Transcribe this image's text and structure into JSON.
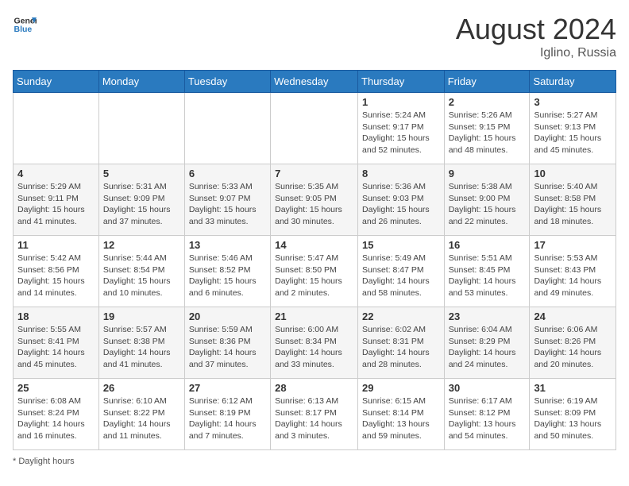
{
  "header": {
    "logo_line1": "General",
    "logo_line2": "Blue",
    "month_year": "August 2024",
    "location": "Iglino, Russia"
  },
  "footer": {
    "note": "Daylight hours"
  },
  "weekdays": [
    "Sunday",
    "Monday",
    "Tuesday",
    "Wednesday",
    "Thursday",
    "Friday",
    "Saturday"
  ],
  "weeks": [
    [
      {
        "day": "",
        "info": ""
      },
      {
        "day": "",
        "info": ""
      },
      {
        "day": "",
        "info": ""
      },
      {
        "day": "",
        "info": ""
      },
      {
        "day": "1",
        "info": "Sunrise: 5:24 AM\nSunset: 9:17 PM\nDaylight: 15 hours\nand 52 minutes."
      },
      {
        "day": "2",
        "info": "Sunrise: 5:26 AM\nSunset: 9:15 PM\nDaylight: 15 hours\nand 48 minutes."
      },
      {
        "day": "3",
        "info": "Sunrise: 5:27 AM\nSunset: 9:13 PM\nDaylight: 15 hours\nand 45 minutes."
      }
    ],
    [
      {
        "day": "4",
        "info": "Sunrise: 5:29 AM\nSunset: 9:11 PM\nDaylight: 15 hours\nand 41 minutes."
      },
      {
        "day": "5",
        "info": "Sunrise: 5:31 AM\nSunset: 9:09 PM\nDaylight: 15 hours\nand 37 minutes."
      },
      {
        "day": "6",
        "info": "Sunrise: 5:33 AM\nSunset: 9:07 PM\nDaylight: 15 hours\nand 33 minutes."
      },
      {
        "day": "7",
        "info": "Sunrise: 5:35 AM\nSunset: 9:05 PM\nDaylight: 15 hours\nand 30 minutes."
      },
      {
        "day": "8",
        "info": "Sunrise: 5:36 AM\nSunset: 9:03 PM\nDaylight: 15 hours\nand 26 minutes."
      },
      {
        "day": "9",
        "info": "Sunrise: 5:38 AM\nSunset: 9:00 PM\nDaylight: 15 hours\nand 22 minutes."
      },
      {
        "day": "10",
        "info": "Sunrise: 5:40 AM\nSunset: 8:58 PM\nDaylight: 15 hours\nand 18 minutes."
      }
    ],
    [
      {
        "day": "11",
        "info": "Sunrise: 5:42 AM\nSunset: 8:56 PM\nDaylight: 15 hours\nand 14 minutes."
      },
      {
        "day": "12",
        "info": "Sunrise: 5:44 AM\nSunset: 8:54 PM\nDaylight: 15 hours\nand 10 minutes."
      },
      {
        "day": "13",
        "info": "Sunrise: 5:46 AM\nSunset: 8:52 PM\nDaylight: 15 hours\nand 6 minutes."
      },
      {
        "day": "14",
        "info": "Sunrise: 5:47 AM\nSunset: 8:50 PM\nDaylight: 15 hours\nand 2 minutes."
      },
      {
        "day": "15",
        "info": "Sunrise: 5:49 AM\nSunset: 8:47 PM\nDaylight: 14 hours\nand 58 minutes."
      },
      {
        "day": "16",
        "info": "Sunrise: 5:51 AM\nSunset: 8:45 PM\nDaylight: 14 hours\nand 53 minutes."
      },
      {
        "day": "17",
        "info": "Sunrise: 5:53 AM\nSunset: 8:43 PM\nDaylight: 14 hours\nand 49 minutes."
      }
    ],
    [
      {
        "day": "18",
        "info": "Sunrise: 5:55 AM\nSunset: 8:41 PM\nDaylight: 14 hours\nand 45 minutes."
      },
      {
        "day": "19",
        "info": "Sunrise: 5:57 AM\nSunset: 8:38 PM\nDaylight: 14 hours\nand 41 minutes."
      },
      {
        "day": "20",
        "info": "Sunrise: 5:59 AM\nSunset: 8:36 PM\nDaylight: 14 hours\nand 37 minutes."
      },
      {
        "day": "21",
        "info": "Sunrise: 6:00 AM\nSunset: 8:34 PM\nDaylight: 14 hours\nand 33 minutes."
      },
      {
        "day": "22",
        "info": "Sunrise: 6:02 AM\nSunset: 8:31 PM\nDaylight: 14 hours\nand 28 minutes."
      },
      {
        "day": "23",
        "info": "Sunrise: 6:04 AM\nSunset: 8:29 PM\nDaylight: 14 hours\nand 24 minutes."
      },
      {
        "day": "24",
        "info": "Sunrise: 6:06 AM\nSunset: 8:26 PM\nDaylight: 14 hours\nand 20 minutes."
      }
    ],
    [
      {
        "day": "25",
        "info": "Sunrise: 6:08 AM\nSunset: 8:24 PM\nDaylight: 14 hours\nand 16 minutes."
      },
      {
        "day": "26",
        "info": "Sunrise: 6:10 AM\nSunset: 8:22 PM\nDaylight: 14 hours\nand 11 minutes."
      },
      {
        "day": "27",
        "info": "Sunrise: 6:12 AM\nSunset: 8:19 PM\nDaylight: 14 hours\nand 7 minutes."
      },
      {
        "day": "28",
        "info": "Sunrise: 6:13 AM\nSunset: 8:17 PM\nDaylight: 14 hours\nand 3 minutes."
      },
      {
        "day": "29",
        "info": "Sunrise: 6:15 AM\nSunset: 8:14 PM\nDaylight: 13 hours\nand 59 minutes."
      },
      {
        "day": "30",
        "info": "Sunrise: 6:17 AM\nSunset: 8:12 PM\nDaylight: 13 hours\nand 54 minutes."
      },
      {
        "day": "31",
        "info": "Sunrise: 6:19 AM\nSunset: 8:09 PM\nDaylight: 13 hours\nand 50 minutes."
      }
    ]
  ]
}
